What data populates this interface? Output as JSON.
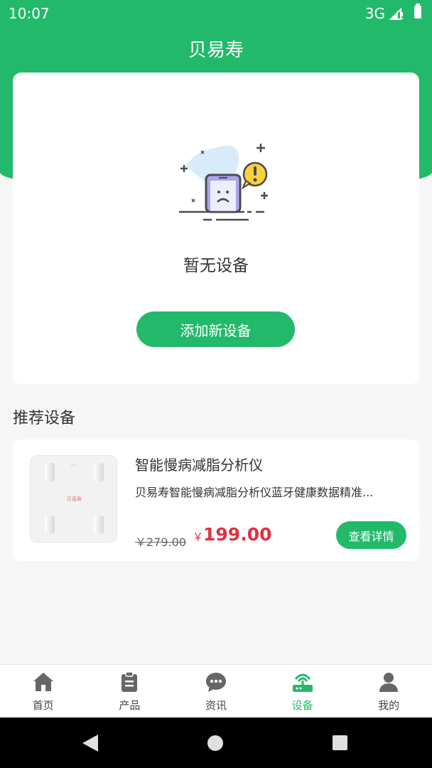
{
  "status_bar": {
    "time": "10:07",
    "network": "3G"
  },
  "header": {
    "title": "贝易寿"
  },
  "empty_state": {
    "message": "暂无设备",
    "add_button_label": "添加新设备"
  },
  "recommended": {
    "section_title": "推荐设备",
    "product": {
      "image_brand_text": "贝易寿",
      "name": "智能慢病减脂分析仪",
      "description": "贝易寿智能慢病减脂分析仪蓝牙健康数据精准...",
      "original_price": "￥279.00",
      "currency_symbol": "￥",
      "current_price": "199.00",
      "details_button_label": "查看详情"
    }
  },
  "bottom_nav": {
    "items": [
      {
        "label": "首页",
        "icon": "home-icon"
      },
      {
        "label": "产品",
        "icon": "clipboard-icon"
      },
      {
        "label": "资讯",
        "icon": "chat-bubble-icon"
      },
      {
        "label": "设备",
        "icon": "router-icon",
        "active": true
      },
      {
        "label": "我的",
        "icon": "user-icon"
      }
    ]
  },
  "colors": {
    "primary": "#23b96b",
    "price": "#e2303f",
    "background": "#f6f6f6"
  }
}
